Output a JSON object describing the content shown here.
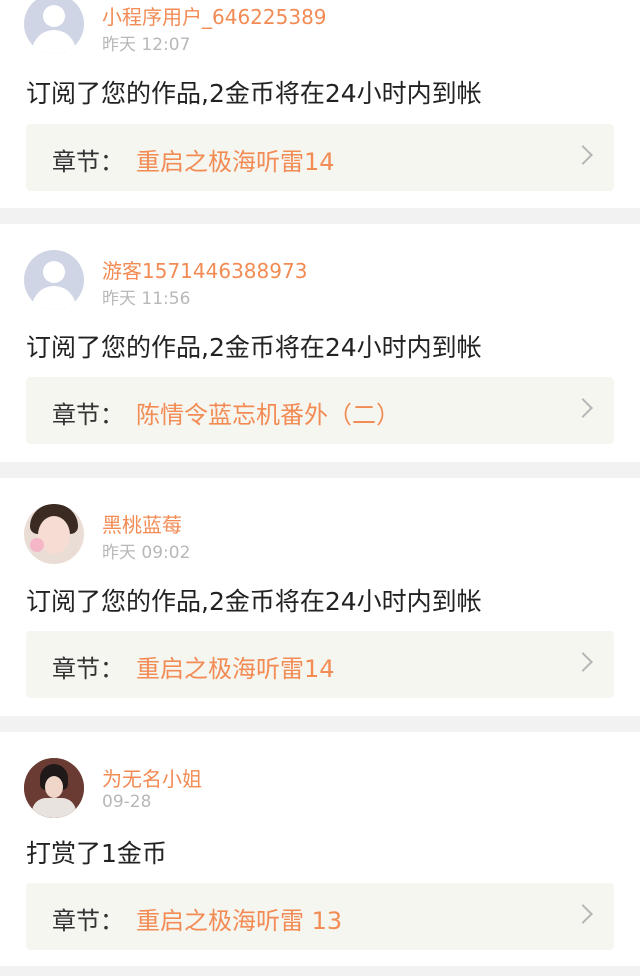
{
  "items": [
    {
      "username": "小程序用户_646225389",
      "time": "昨天 12:07",
      "message": "订阅了您的作品,2金币将在24小时内到帐",
      "chapter_label": "章节：",
      "chapter_title": "重启之极海听雷14",
      "avatar": "default-avatar"
    },
    {
      "username": "游客1571446388973",
      "time": "昨天 11:56",
      "message": "订阅了您的作品,2金币将在24小时内到帐",
      "chapter_label": "章节：",
      "chapter_title": "陈情令蓝忘机番外（二）",
      "avatar": "default-avatar"
    },
    {
      "username": "黑桃蓝莓",
      "time": "昨天 09:02",
      "message": "订阅了您的作品,2金币将在24小时内到帐",
      "chapter_label": "章节：",
      "chapter_title": "重启之极海听雷14",
      "avatar": "user-photo"
    },
    {
      "username": "为无名小姐",
      "time": "09-28",
      "message": "打赏了1金币",
      "chapter_label": "章节：",
      "chapter_title": "重启之极海听雷 13",
      "avatar": "user-photo"
    }
  ],
  "colors": {
    "accent": "#f28b54",
    "separator": "#f2f2f2",
    "chapter_bg": "#f6f6f1"
  }
}
